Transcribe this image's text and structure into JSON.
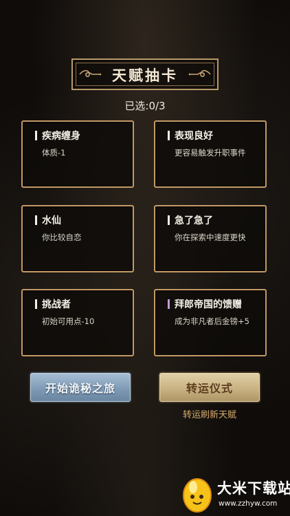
{
  "title": "天赋抽卡",
  "selected": {
    "label": "已选:",
    "count": "0/3"
  },
  "cards": [
    {
      "name": "疾病缠身",
      "desc": "体质-1",
      "rarity_color": "#f4f1ec"
    },
    {
      "name": "表现良好",
      "desc": "更容易触发升职事件",
      "rarity_color": "#f4f1ec"
    },
    {
      "name": "水仙",
      "desc": "你比较自恋",
      "rarity_color": "#f4f1ec"
    },
    {
      "name": "急了急了",
      "desc": "你在探索中速度更快",
      "rarity_color": "#f4f1ec"
    },
    {
      "name": "挑战者",
      "desc": "初始可用点-10",
      "rarity_color": "#f4f1ec"
    },
    {
      "name": "拜郎帝国的馈赠",
      "desc": "成为非凡者后金镑+5",
      "rarity_color": "#c89ad8"
    }
  ],
  "buttons": {
    "start": "开始诡秘之旅",
    "luck": "转运仪式",
    "luck_caption": "转运刷新天赋"
  },
  "watermark": {
    "title": "大米下载站",
    "url": "www.zzhyw.com"
  },
  "colors": {
    "card_border": "#c49a67",
    "start_button": "#7f9bb6",
    "luck_button": "#c9b283",
    "caption": "#d9ad6e"
  }
}
